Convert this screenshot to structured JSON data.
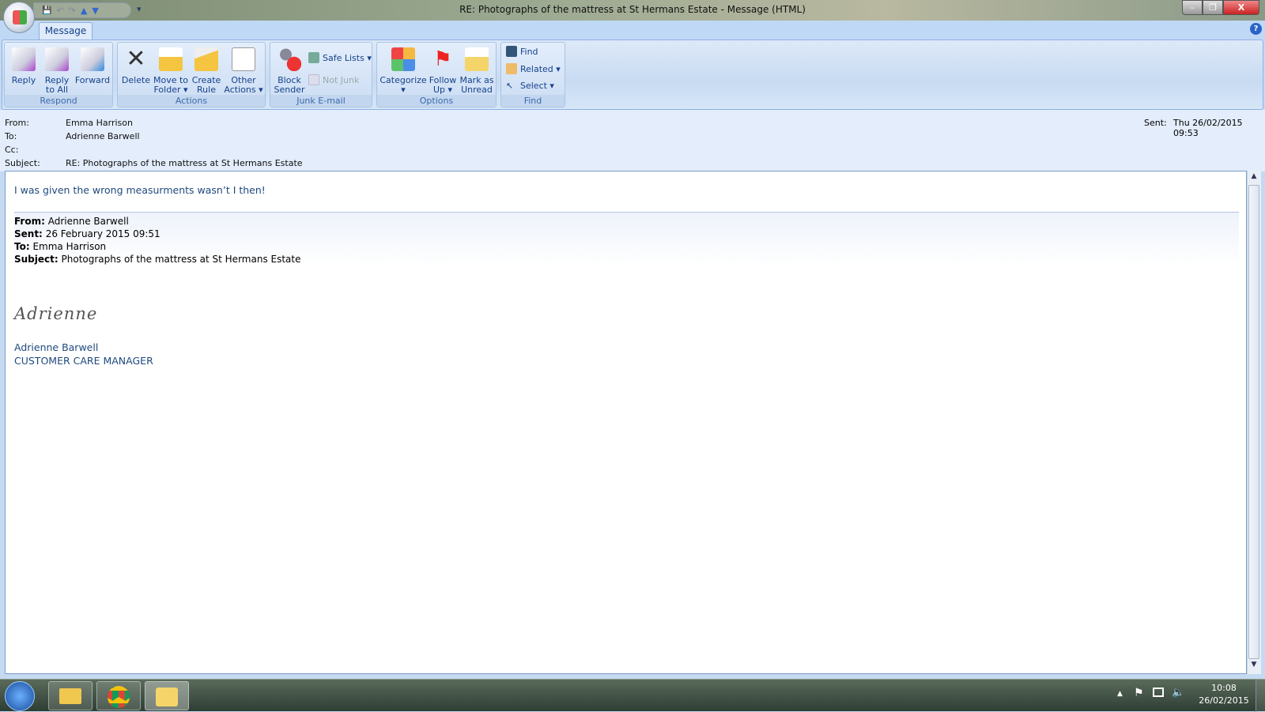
{
  "window": {
    "title": "RE: Photographs of the mattress at St Hermans Estate  -  Message (HTML)",
    "minimize": "–",
    "restore": "❐",
    "close": "X"
  },
  "qat": {
    "save": "💾",
    "undo": "↶",
    "redo": "↷",
    "up": "▲",
    "down": "▼",
    "customize": "▾"
  },
  "tabs": [
    {
      "label": "Message"
    }
  ],
  "help": "?",
  "ribbon": {
    "respond": {
      "label": "Respond",
      "reply": "Reply",
      "reply_all_1": "Reply",
      "reply_all_2": "to All",
      "forward": "Forward"
    },
    "actions": {
      "label": "Actions",
      "delete": "Delete",
      "move_1": "Move to",
      "move_2": "Folder ▾",
      "rule_1": "Create",
      "rule_2": "Rule",
      "other_1": "Other",
      "other_2": "Actions ▾"
    },
    "junk": {
      "label": "Junk E-mail",
      "block_1": "Block",
      "block_2": "Sender",
      "safe_lists": "Safe Lists ▾",
      "not_junk": "Not Junk"
    },
    "options": {
      "label": "Options",
      "categorize": "Categorize",
      "categorize_2": "▾",
      "follow_1": "Follow",
      "follow_2": "Up ▾",
      "mark_1": "Mark as",
      "mark_2": "Unread"
    },
    "find": {
      "label": "Find",
      "find": "Find",
      "related": "Related ▾",
      "select": "Select ▾"
    }
  },
  "header": {
    "from_label": "From:",
    "from": "Emma Harrison",
    "to_label": "To:",
    "to": "Adrienne Barwell",
    "cc_label": "Cc:",
    "subject_label": "Subject:",
    "subject": "RE: Photographs of the mattress at St Hermans Estate",
    "sent_label": "Sent:",
    "sent": "Thu 26/02/2015 09:53"
  },
  "body": {
    "reply": "I was given the wrong measurments wasn’t I then!",
    "quoted": {
      "from_label": "From:",
      "from": "Adrienne Barwell",
      "sent_label": "Sent:",
      "sent": "26 February 2015 09:51",
      "to_label": "To:",
      "to": "Emma Harrison",
      "subject_label": "Subject:",
      "subject": "Photographs of the mattress at St Hermans Estate"
    },
    "signature_script": "Adrienne",
    "signature_name": "Adrienne Barwell",
    "signature_title": "CUSTOMER CARE MANAGER"
  },
  "taskbar": {
    "time": "10:08",
    "date": "26/02/2015"
  }
}
